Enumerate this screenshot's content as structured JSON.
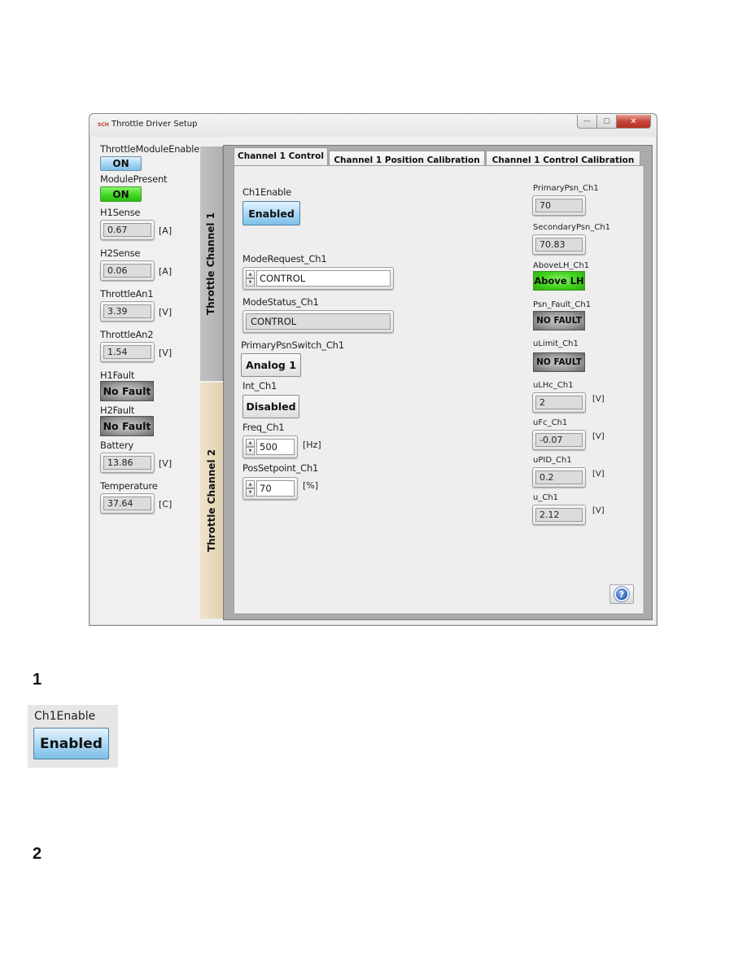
{
  "window": {
    "title": "Throttle Driver Setup",
    "app_icon": "SCH",
    "controls": {
      "minimize": "—",
      "maximize": "▢",
      "close": "✕"
    }
  },
  "left_panel": {
    "throttle_module_enable": {
      "label": "ThrottleModuleEnable",
      "value": "ON"
    },
    "module_present": {
      "label": "ModulePresent",
      "value": "ON"
    },
    "indicators": [
      {
        "label": "H1Sense",
        "value": "0.67",
        "unit": "[A]"
      },
      {
        "label": "H2Sense",
        "value": "0.06",
        "unit": "[A]"
      },
      {
        "label": "ThrottleAn1",
        "value": "3.39",
        "unit": "[V]"
      },
      {
        "label": "ThrottleAn2",
        "value": "1.54",
        "unit": "[V]"
      }
    ],
    "faults": [
      {
        "label": "H1Fault",
        "value": "No Fault"
      },
      {
        "label": "H2Fault",
        "value": "No Fault"
      }
    ],
    "battery": {
      "label": "Battery",
      "value": "13.86",
      "unit": "[V]"
    },
    "temperature": {
      "label": "Temperature",
      "value": "37.64",
      "unit": "[C]"
    }
  },
  "channel_tabs": [
    {
      "label": "Throttle Channel 1",
      "active": true
    },
    {
      "label": "Throttle Channel 2",
      "active": false
    }
  ],
  "tabs": [
    {
      "label": "Channel 1 Control",
      "active": true
    },
    {
      "label": "Channel 1 Position Calibration",
      "active": false
    },
    {
      "label": "Channel 1 Control Calibration",
      "active": false
    }
  ],
  "controls": {
    "ch1_enable": {
      "label": "Ch1Enable",
      "value": "Enabled"
    },
    "mode_request": {
      "label": "ModeRequest_Ch1",
      "value": "CONTROL"
    },
    "mode_status": {
      "label": "ModeStatus_Ch1",
      "value": "CONTROL"
    },
    "primary_psn_switch": {
      "label": "PrimaryPsnSwitch_Ch1",
      "value": "Analog 1"
    },
    "init": {
      "label": "Int_Ch1",
      "value": "Disabled"
    },
    "freq": {
      "label": "Freq_Ch1",
      "value": "500",
      "unit": "[Hz]"
    },
    "pos_setpoint": {
      "label": "PosSetpoint_Ch1",
      "value": "70",
      "unit": "[%]"
    }
  },
  "readouts": {
    "primary_psn": {
      "label": "PrimaryPsn_Ch1",
      "value": "70"
    },
    "secondary_psn": {
      "label": "SecondaryPsn_Ch1",
      "value": "70.83"
    },
    "above_lh": {
      "label": "AboveLH_Ch1",
      "value": "Above LH"
    },
    "psn_fault": {
      "label": "Psn_Fault_Ch1",
      "value": "NO FAULT"
    },
    "ulimit": {
      "label": "uLimit_Ch1",
      "value": "NO FAULT"
    },
    "ulhc": {
      "label": "uLHc_Ch1",
      "value": "2",
      "unit": "[V]"
    },
    "ufc": {
      "label": "uFc_Ch1",
      "value": "-0.07",
      "unit": "[V]"
    },
    "upid": {
      "label": "uPID_Ch1",
      "value": "0.2",
      "unit": "[V]"
    },
    "u": {
      "label": "u_Ch1",
      "value": "2.12",
      "unit": "[V]"
    }
  },
  "help": {
    "icon": "?"
  },
  "document": {
    "section1": "1",
    "inset": {
      "label": "Ch1Enable",
      "value": "Enabled"
    },
    "section2": "2"
  },
  "colors": {
    "active_blue": "#7cbfe8",
    "led_green": "#43d21e",
    "channel2_tab": "#e1d1b1"
  }
}
